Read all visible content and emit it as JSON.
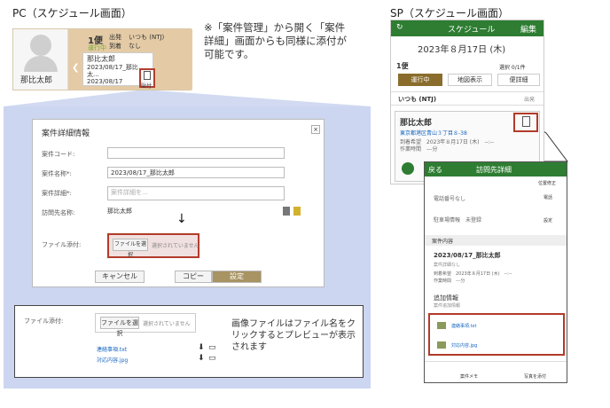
{
  "labels": {
    "pc": "PC（スケジュール画面）",
    "sp": "SP（スケジュール画面）"
  },
  "pc_strip": {
    "user_name": "那比太郎",
    "slot": "1便",
    "slot_status": "運行中",
    "departure": "出発",
    "arrival": "到着",
    "depart_where": "いつも (NTJ)",
    "arrive_where": "なし",
    "card_name": "那比太郎",
    "card_line1": "2023/08/17_那比太...",
    "card_line2": "2023/08/17",
    "attach_label": "貼付"
  },
  "note": "※「案件管理」から開く「案件詳細」画面からも同様に添付が可能です。",
  "sp_phone": {
    "title": "スケジュール",
    "edit": "編集",
    "date": "2023年８月17日 (木)",
    "slot": "1便",
    "slot_count": "選択 0/1件",
    "tab_running": "運行中",
    "tab_map": "地図表示",
    "tab_convenient": "便詳細",
    "depart": "いつも (NTJ)",
    "depart_tag": "出発",
    "card_name": "那比太郎",
    "card_address": "東京都港区青山３丁目８-38",
    "card_line1": "到着希望　2023年８月17日 (木)　--:--",
    "card_line2": "作業時間　---分"
  },
  "modal": {
    "title": "案件詳細情報",
    "code_label": "案件コード:",
    "name_label": "案件名称*:",
    "name_value": "2023/08/17_那比太郎",
    "detail_label": "案件詳細*:",
    "detail_placeholder": "案件詳細を...",
    "visit_label": "訪問先名称:",
    "visit_value": "那比太郎",
    "file_label": "ファイル添付:",
    "choose_file": "ファイルを選択",
    "no_file": "選択されていません",
    "cancel": "キャンセル",
    "copy": "コピー",
    "save": "設定"
  },
  "zoom": {
    "file_label": "ファイル添付:",
    "choose_file": "ファイルを選択",
    "no_file": "選択されていません",
    "file1": "連絡事項.txt",
    "file2": "対応内容.jpg",
    "explain": "画像ファイルはファイル名をクリックするとプレビューが表示されます"
  },
  "sp_detail": {
    "back": "戻る",
    "title": "訪問先詳細",
    "pos_label": "位置修正",
    "phone_none": "電話番号なし",
    "phone_label": "電話",
    "parking": "駐車場情報　未登録",
    "settings": "設定",
    "section_case": "案件内容",
    "case_name": "2023/08/17_那比太郎",
    "case_sub": "案件詳細なし",
    "arrive": "到着希望　2023年８月17日 (木)　--:--",
    "work": "作業時間　---分",
    "extra": "追加情報",
    "extra_sub": "案件追加情報",
    "file1": "連絡事項.txt",
    "file2": "対応内容.jpg",
    "memo": "案件メモ",
    "photo": "写真を添付"
  }
}
